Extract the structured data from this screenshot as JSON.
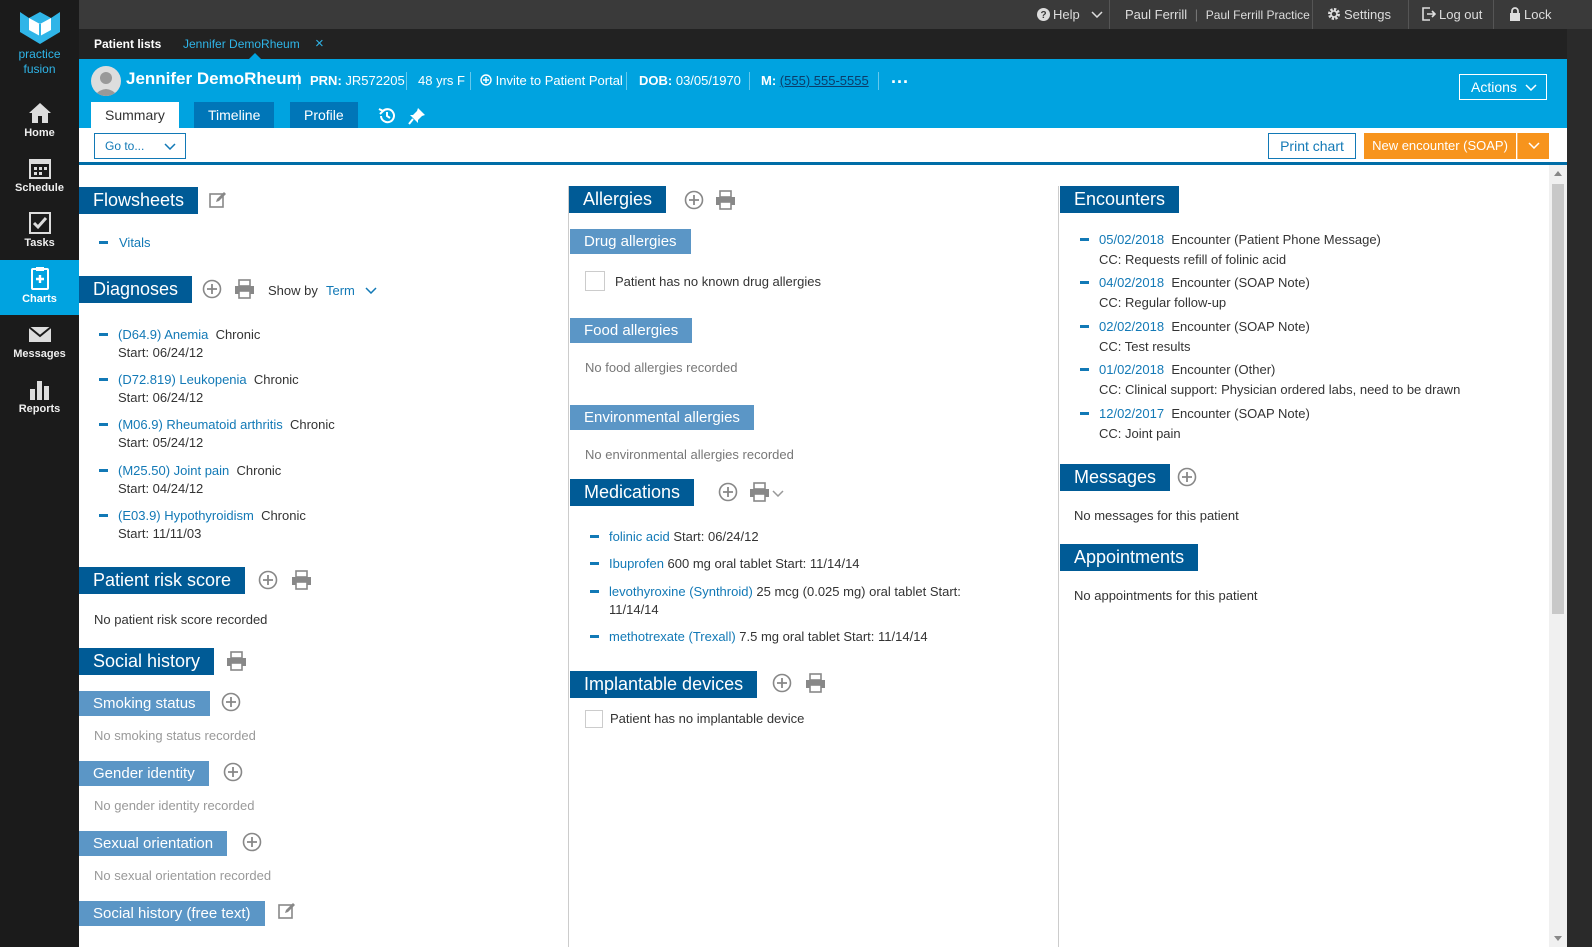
{
  "nav": {
    "logo_line1": "practice",
    "logo_line2": "fusion",
    "items": [
      {
        "label": "Home",
        "icon": "home-icon"
      },
      {
        "label": "Schedule",
        "icon": "calendar-icon"
      },
      {
        "label": "Tasks",
        "icon": "checkbox-icon"
      },
      {
        "label": "Charts",
        "icon": "chart-plus-icon"
      },
      {
        "label": "Messages",
        "icon": "envelope-icon"
      },
      {
        "label": "Reports",
        "icon": "bar-chart-icon"
      }
    ],
    "active": "Charts",
    "active_color": "#00a3e0"
  },
  "topbar": {
    "help": "Help",
    "user": "Paul Ferrill",
    "practice": "Paul Ferrill Practice",
    "settings": "Settings",
    "logout": "Log out",
    "lock": "Lock"
  },
  "tabs": {
    "patient_lists": "Patient lists",
    "open_patient": "Jennifer DemoRheum",
    "close": "×"
  },
  "patient": {
    "name": "Jennifer DemoRheum",
    "prn_label": "PRN:",
    "prn": "JR572205",
    "age_sex": "48 yrs F",
    "portal": "Invite to Patient Portal",
    "dob_label": "DOB:",
    "dob": "03/05/1970",
    "mobile_label": "M:",
    "mobile": "(555) 555-5555",
    "more": "...",
    "actions": "Actions",
    "tabs": [
      "Summary",
      "Timeline",
      "Profile"
    ],
    "header_color": "#00a3e0"
  },
  "toolbar": {
    "goto": "Go to...",
    "print_chart": "Print chart",
    "new_encounter": "New encounter (SOAP)",
    "accent_orange": "#f7941d"
  },
  "flowsheets": {
    "title": "Flowsheets",
    "items": [
      "Vitals"
    ]
  },
  "diagnoses": {
    "title": "Diagnoses",
    "show_by_label": "Show by",
    "show_by_value": "Term",
    "items": [
      {
        "code": "(D64.9) Anemia",
        "status": "Chronic",
        "start": "Start: 06/24/12"
      },
      {
        "code": "(D72.819) Leukopenia",
        "status": "Chronic",
        "start": "Start: 06/24/12"
      },
      {
        "code": "(M06.9) Rheumatoid arthritis",
        "status": "Chronic",
        "start": "Start: 05/24/12"
      },
      {
        "code": "(M25.50) Joint pain",
        "status": "Chronic",
        "start": "Start: 04/24/12"
      },
      {
        "code": "(E03.9) Hypothyroidism",
        "status": "Chronic",
        "start": "Start: 11/11/03"
      }
    ]
  },
  "risk": {
    "title": "Patient risk score",
    "empty": "No patient risk score recorded"
  },
  "social": {
    "title": "Social history",
    "smoking_title": "Smoking status",
    "smoking_empty": "No smoking status recorded",
    "gender_title": "Gender identity",
    "gender_empty": "No gender identity recorded",
    "orientation_title": "Sexual orientation",
    "orientation_empty": "No sexual orientation recorded",
    "freetext_title": "Social history (free text)"
  },
  "allergies": {
    "title": "Allergies",
    "drug_title": "Drug allergies",
    "drug_checkbox": "Patient has no known drug allergies",
    "food_title": "Food allergies",
    "food_empty": "No food allergies recorded",
    "env_title": "Environmental allergies",
    "env_empty": "No environmental allergies recorded"
  },
  "medications": {
    "title": "Medications",
    "items": [
      {
        "name": "folinic acid",
        "detail": " Start: 06/24/12",
        "detail2": ""
      },
      {
        "name": "Ibuprofen",
        "detail": " 600 mg oral tablet Start: 11/14/14",
        "detail2": ""
      },
      {
        "name": "levothyroxine (Synthroid)",
        "detail": " 25 mcg (0.025 mg) oral tablet Start:",
        "detail2": "11/14/14"
      },
      {
        "name": "methotrexate (Trexall)",
        "detail": " 7.5 mg oral tablet Start: 11/14/14",
        "detail2": ""
      }
    ]
  },
  "devices": {
    "title": "Implantable devices",
    "checkbox": "Patient has no implantable device"
  },
  "encounters": {
    "title": "Encounters",
    "items": [
      {
        "date": "05/02/2018",
        "type": "Encounter (Patient Phone Message)",
        "cc": "CC: Requests refill of folinic acid"
      },
      {
        "date": "04/02/2018",
        "type": "Encounter (SOAP Note)",
        "cc": "CC: Regular follow-up"
      },
      {
        "date": "02/02/2018",
        "type": "Encounter (SOAP Note)",
        "cc": "CC: Test results"
      },
      {
        "date": "01/02/2018",
        "type": "Encounter (Other)",
        "cc": "CC: Clinical support: Physician ordered labs, need to be drawn"
      },
      {
        "date": "12/02/2017",
        "type": "Encounter (SOAP Note)",
        "cc": "CC: Joint pain"
      }
    ]
  },
  "messages": {
    "title": "Messages",
    "empty": "No messages for this patient"
  },
  "appointments": {
    "title": "Appointments",
    "empty": "No appointments for this patient"
  }
}
